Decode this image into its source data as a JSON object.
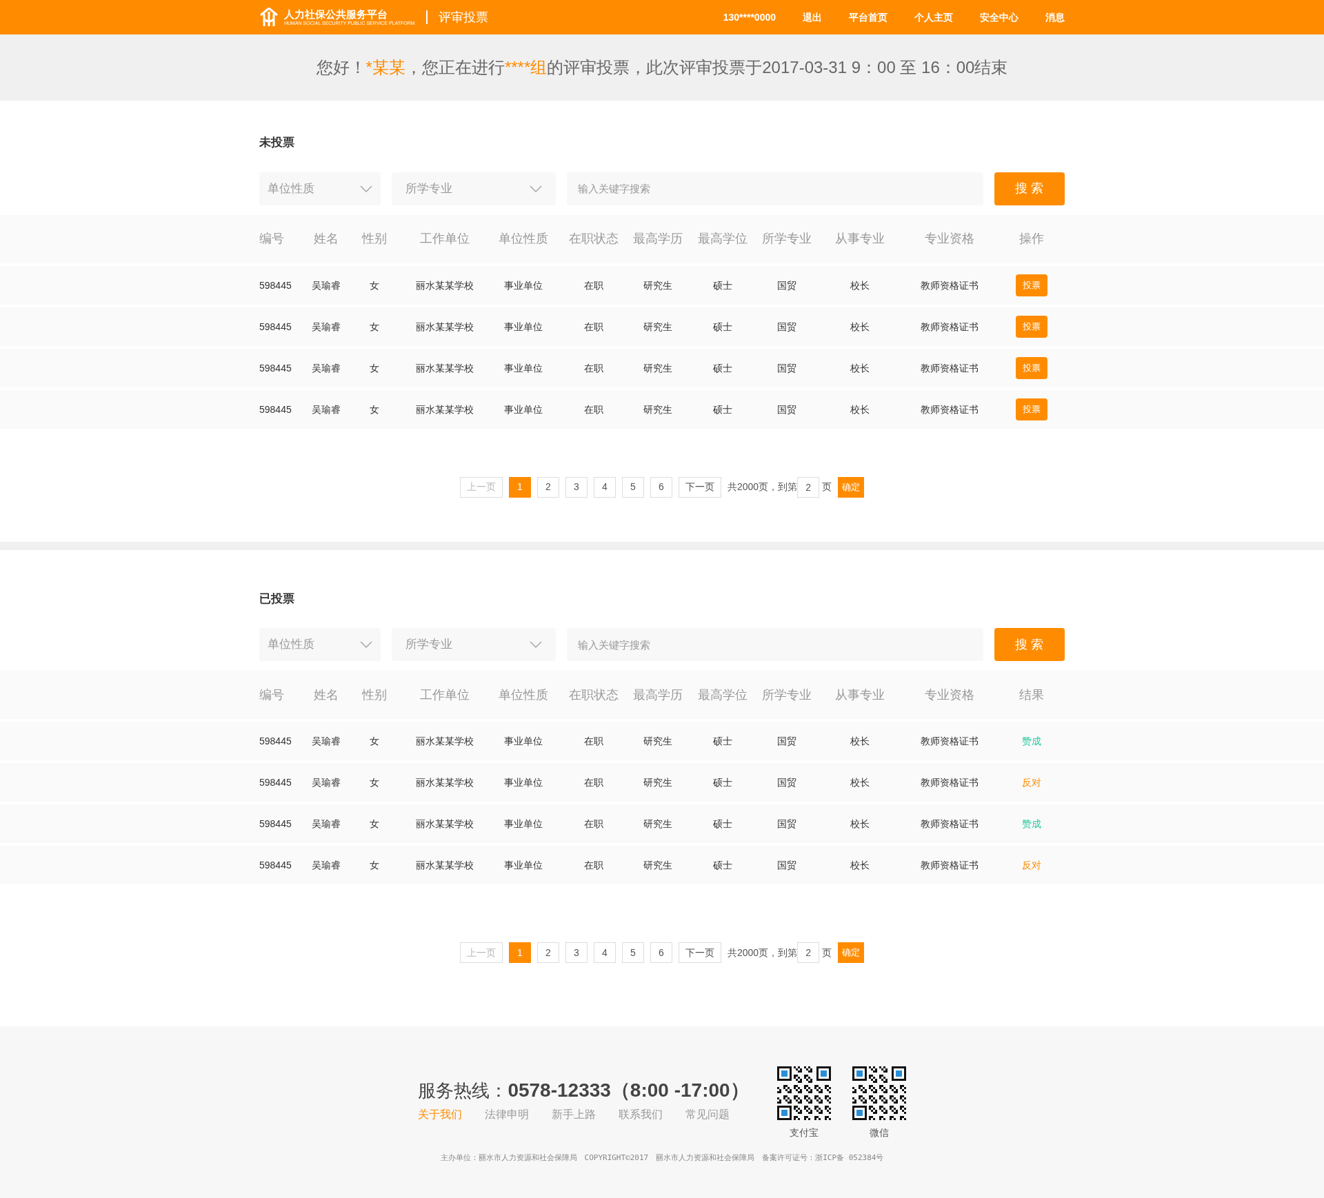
{
  "header": {
    "logo_title": "人力社保公共服务平台",
    "logo_subtitle": "HUMAN SOCIAL SECURITY PUBLIC SERVICE PLATFORM",
    "page_title": "评审投票",
    "nav": [
      "130****0000",
      "退出",
      "平台首页",
      "个人主页",
      "安全中心",
      "消息"
    ]
  },
  "greeting": [
    {
      "text": "您好！",
      "highlight": false
    },
    {
      "text": "*某某",
      "highlight": true
    },
    {
      "text": "，您正在进行",
      "highlight": false
    },
    {
      "text": "****组",
      "highlight": true
    },
    {
      "text": "的评审投票，此次评审投票于2017-03-31 9：00 至 16：00结束",
      "highlight": false
    }
  ],
  "sections": [
    {
      "title": "未投票",
      "filters": {
        "unit_type": "单位性质",
        "major": "所学专业",
        "search_placeholder": "输入关键字搜索",
        "search_button": "搜 索"
      },
      "columns": [
        "编号",
        "姓名",
        "性别",
        "工作单位",
        "单位性质",
        "在职状态",
        "最高学历",
        "最高学位",
        "所学专业",
        "从事专业",
        "专业资格",
        "操作"
      ],
      "rows": [
        {
          "cells": [
            "598445",
            "吴瑜睿",
            "女",
            "丽水某某学校",
            "事业单位",
            "在职",
            "研究生",
            "硕士",
            "国贸",
            "校长",
            "教师资格证书"
          ],
          "action": {
            "kind": "button",
            "text": "投票"
          }
        },
        {
          "cells": [
            "598445",
            "吴瑜睿",
            "女",
            "丽水某某学校",
            "事业单位",
            "在职",
            "研究生",
            "硕士",
            "国贸",
            "校长",
            "教师资格证书"
          ],
          "action": {
            "kind": "button",
            "text": "投票"
          }
        },
        {
          "cells": [
            "598445",
            "吴瑜睿",
            "女",
            "丽水某某学校",
            "事业单位",
            "在职",
            "研究生",
            "硕士",
            "国贸",
            "校长",
            "教师资格证书"
          ],
          "action": {
            "kind": "button",
            "text": "投票"
          }
        },
        {
          "cells": [
            "598445",
            "吴瑜睿",
            "女",
            "丽水某某学校",
            "事业单位",
            "在职",
            "研究生",
            "硕士",
            "国贸",
            "校长",
            "教师资格证书"
          ],
          "action": {
            "kind": "button",
            "text": "投票"
          }
        }
      ],
      "pagination": {
        "prev": {
          "label": "上一页",
          "disabled": true
        },
        "pages": [
          {
            "label": "1",
            "selected": true
          },
          {
            "label": "2",
            "selected": false
          },
          {
            "label": "3",
            "selected": false
          },
          {
            "label": "4",
            "selected": false
          },
          {
            "label": "5",
            "selected": false
          },
          {
            "label": "6",
            "selected": false
          }
        ],
        "next": {
          "label": "下一页",
          "disabled": false
        },
        "total": "共2000页，到第",
        "page_input": "2",
        "page_suffix": "页",
        "confirm": "确定"
      }
    },
    {
      "title": "已投票",
      "filters": {
        "unit_type": "单位性质",
        "major": "所学专业",
        "search_placeholder": "输入关键字搜索",
        "search_button": "搜 索"
      },
      "columns": [
        "编号",
        "姓名",
        "性别",
        "工作单位",
        "单位性质",
        "在职状态",
        "最高学历",
        "最高学位",
        "所学专业",
        "从事专业",
        "专业资格",
        "结果"
      ],
      "rows": [
        {
          "cells": [
            "598445",
            "吴瑜睿",
            "女",
            "丽水某某学校",
            "事业单位",
            "在职",
            "研究生",
            "硕士",
            "国贸",
            "校长",
            "教师资格证书"
          ],
          "action": {
            "kind": "result",
            "text": "赞成",
            "color": "#2ec7a0"
          }
        },
        {
          "cells": [
            "598445",
            "吴瑜睿",
            "女",
            "丽水某某学校",
            "事业单位",
            "在职",
            "研究生",
            "硕士",
            "国贸",
            "校长",
            "教师资格证书"
          ],
          "action": {
            "kind": "result",
            "text": "反对",
            "color": "#ff8c00"
          }
        },
        {
          "cells": [
            "598445",
            "吴瑜睿",
            "女",
            "丽水某某学校",
            "事业单位",
            "在职",
            "研究生",
            "硕士",
            "国贸",
            "校长",
            "教师资格证书"
          ],
          "action": {
            "kind": "result",
            "text": "赞成",
            "color": "#2ec7a0"
          }
        },
        {
          "cells": [
            "598445",
            "吴瑜睿",
            "女",
            "丽水某某学校",
            "事业单位",
            "在职",
            "研究生",
            "硕士",
            "国贸",
            "校长",
            "教师资格证书"
          ],
          "action": {
            "kind": "result",
            "text": "反对",
            "color": "#ff8c00"
          }
        }
      ],
      "pagination": {
        "prev": {
          "label": "上一页",
          "disabled": true
        },
        "pages": [
          {
            "label": "1",
            "selected": true
          },
          {
            "label": "2",
            "selected": false
          },
          {
            "label": "3",
            "selected": false
          },
          {
            "label": "4",
            "selected": false
          },
          {
            "label": "5",
            "selected": false
          },
          {
            "label": "6",
            "selected": false
          }
        ],
        "next": {
          "label": "下一页",
          "disabled": false
        },
        "total": "共2000页，到第",
        "page_input": "2",
        "page_suffix": "页",
        "confirm": "确定"
      }
    }
  ],
  "footer": {
    "hotline_label": "服务热线：",
    "hotline_number": "0578-12333（8:00 -17:00）",
    "links": [
      {
        "label": "关于我们",
        "selected": true
      },
      {
        "label": "法律申明",
        "selected": false
      },
      {
        "label": "新手上路",
        "selected": false
      },
      {
        "label": "联系我们",
        "selected": false
      },
      {
        "label": "常见问题",
        "selected": false
      }
    ],
    "qr_codes": [
      "支付宝",
      "微信"
    ],
    "copyright": "主办单位：丽水市人力资源和社会保障局　COPYRIGHT©2017　丽水市人力资源和社会保障局　备案许可证号：浙ICP备 052384号"
  }
}
